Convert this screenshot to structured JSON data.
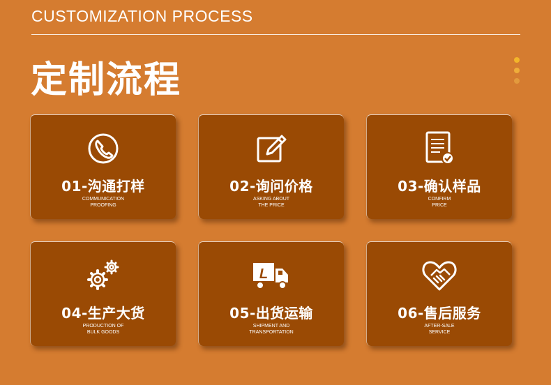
{
  "header": {
    "en_title": "CUSTOMIZATION PROCESS",
    "zh_title": "定制流程"
  },
  "colors": {
    "background": "#d57c30",
    "card": "#9a4a04",
    "dots": [
      "#f3b52a",
      "#efad3a",
      "#e39a3d"
    ]
  },
  "steps": [
    {
      "title": "01-沟通打样",
      "en_line1": "COMMUNICATION",
      "en_line2": "PROOFING",
      "icon": "phone-icon"
    },
    {
      "title": "02-询问价格",
      "en_line1": "ASKING ABOUT",
      "en_line2": "THE PRICE",
      "icon": "edit-icon"
    },
    {
      "title": "03-确认样品",
      "en_line1": "CONFIRM",
      "en_line2": "PRICE",
      "icon": "checklist-icon"
    },
    {
      "title": "04-生产大货",
      "en_line1": "PRODUCTION OF",
      "en_line2": "BULK GOODS",
      "icon": "gears-icon"
    },
    {
      "title": "05-出货运输",
      "en_line1": "SHIPMENT AND",
      "en_line2": "TRANSPORTATION",
      "icon": "truck-icon"
    },
    {
      "title": "06-售后服务",
      "en_line1": "AFTER-SALE",
      "en_line2": "SERVICE",
      "icon": "handshake-heart-icon"
    }
  ]
}
